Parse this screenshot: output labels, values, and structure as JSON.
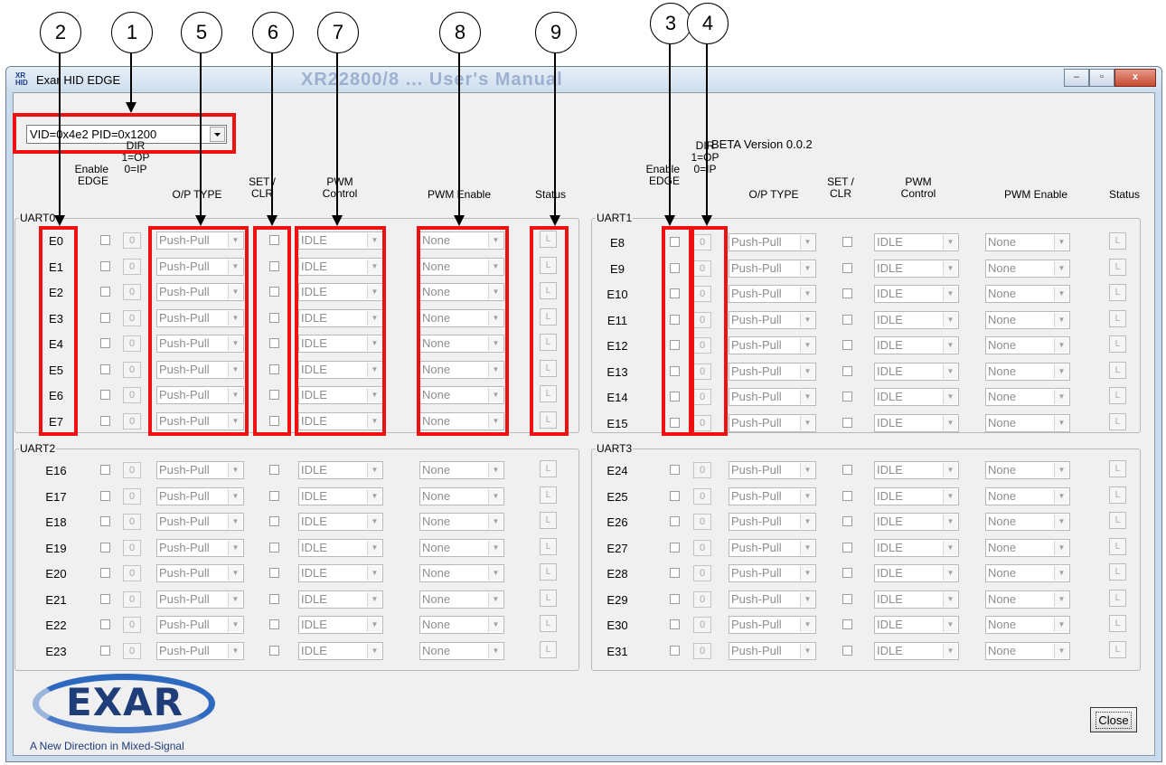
{
  "window": {
    "title": "Exar HID EDGE",
    "app_icon_top": "XR",
    "app_icon_bottom": "HID",
    "background_title": "XR22800/8 ... User's Manual",
    "minimize_glyph": "‒",
    "maximize_glyph": "▫",
    "close_glyph": "x"
  },
  "device_selector": {
    "value": "VID=0x4e2 PID=0x1200"
  },
  "version": "BETA Version 0.0.2",
  "headers": {
    "enable_edge": "Enable\nEDGE",
    "dir": "DIR\n1=OP\n0=IP",
    "op_type": "O/P TYPE",
    "set_clr": "SET /\nCLR",
    "pwm_control": "PWM\nControl",
    "pwm_enable": "PWM Enable",
    "status": "Status"
  },
  "groups": [
    {
      "label": "UART0",
      "pins": [
        "E0",
        "E1",
        "E2",
        "E3",
        "E4",
        "E5",
        "E6",
        "E7"
      ]
    },
    {
      "label": "UART1",
      "pins": [
        "E8",
        "E9",
        "E10",
        "E11",
        "E12",
        "E13",
        "E14",
        "E15"
      ]
    },
    {
      "label": "UART2",
      "pins": [
        "E16",
        "E17",
        "E18",
        "E19",
        "E20",
        "E21",
        "E22",
        "E23"
      ]
    },
    {
      "label": "UART3",
      "pins": [
        "E24",
        "E25",
        "E26",
        "E27",
        "E28",
        "E29",
        "E30",
        "E31"
      ]
    }
  ],
  "row_defaults": {
    "dir_value": "0",
    "op_type": "Push-Pull",
    "pwm_control": "IDLE",
    "pwm_enable": "None",
    "status": "L",
    "dropdown_arrow": "▼"
  },
  "callouts": [
    "1",
    "2",
    "3",
    "4",
    "5",
    "6",
    "7",
    "8",
    "9"
  ],
  "logo": {
    "word": "EXAR",
    "tagline": "A New Direction in Mixed-Signal"
  },
  "close_button": "Close",
  "colors": {
    "annotation_red": "#ee1111",
    "titlebar": "#cddded",
    "dialog_bg": "#f0f0f0",
    "logo_blue": "#1f3d78"
  }
}
